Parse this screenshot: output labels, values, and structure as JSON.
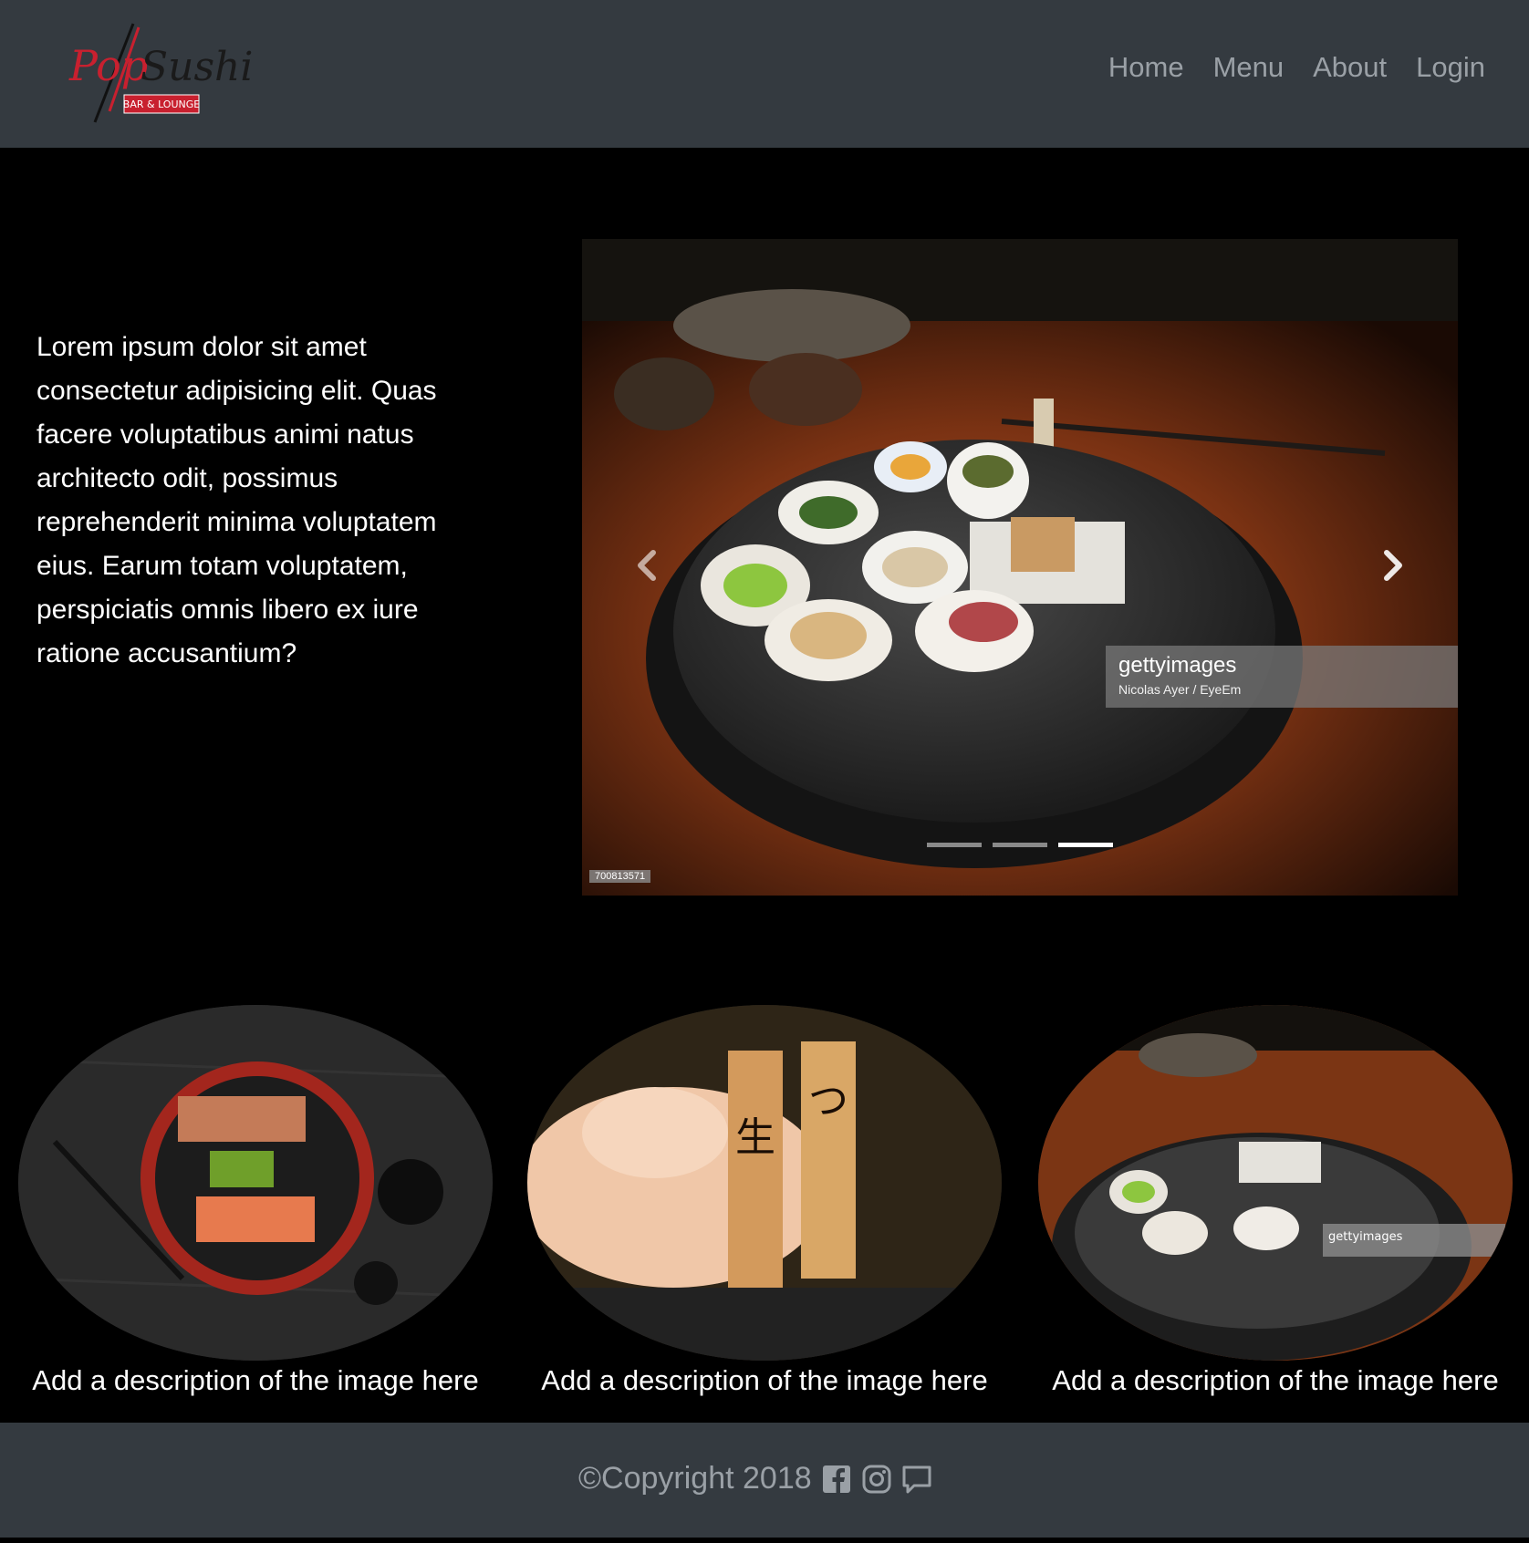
{
  "brand": {
    "logo_text": "PopSushi",
    "logo_sub": "BAR & LOUNGE"
  },
  "nav": {
    "items": [
      {
        "label": "Home"
      },
      {
        "label": "Menu"
      },
      {
        "label": "About"
      },
      {
        "label": "Login"
      }
    ]
  },
  "hero": {
    "text": "Lorem ipsum dolor sit amet consectetur adipisicing elit. Quas facere voluptatibus animi natus architecto odit, possimus reprehenderit minima voluptatem eius. Earum totam voluptatem, perspiciatis omnis libero ex iure ratione accusantium?"
  },
  "carousel": {
    "watermark_brand": "gettyimages",
    "watermark_credit": "Nicolas Ayer / EyeEm",
    "image_id": "700813571",
    "indicator_count": 3,
    "active_indicator": 3
  },
  "gallery": {
    "items": [
      {
        "caption": "Add a description of the image here"
      },
      {
        "caption": "Add a description of the image here"
      },
      {
        "caption": "Add a description of the image here"
      }
    ]
  },
  "footer": {
    "copyright": "©Copyright 2018",
    "icons": [
      "facebook-icon",
      "instagram-icon",
      "chat-icon"
    ]
  },
  "colors": {
    "navbar_bg": "#343a40",
    "body_bg": "#000000",
    "nav_text": "#9aa0a6",
    "logo_red": "#c8202f"
  }
}
